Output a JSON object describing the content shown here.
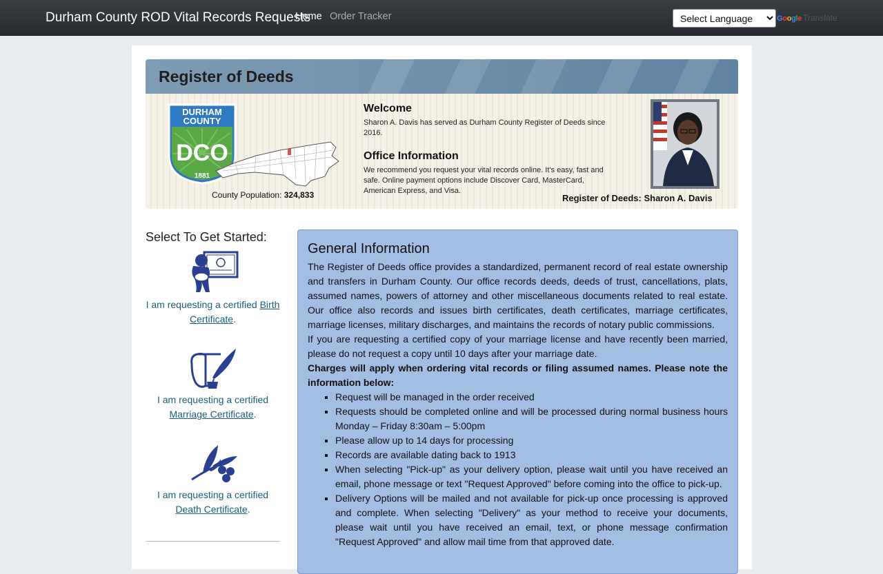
{
  "navbar": {
    "brand": "Durham County ROD Vital Records Requests",
    "home": "Home",
    "order_tracker": "Order Tracker",
    "language_select": "Select Language",
    "google": "Google",
    "translate": "Translate"
  },
  "banner": {
    "title": "Register of Deeds",
    "seal_line1": "DURHAM",
    "seal_line2": "COUNTY",
    "seal_initials": "DCO",
    "seal_year": "1881",
    "population_label": "County Population:",
    "population_value": "324,833",
    "welcome_heading": "Welcome",
    "welcome_text": "Sharon A. Davis has served as Durham County Register of Deeds since 2016.",
    "office_heading": "Office Information",
    "office_text": "We recommend you request your vital records online. It's easy, fast and safe. Online payment options include Discover Card, MasterCard, American Express, and Visa.",
    "register_name": "Register of Deeds: Sharon A. Davis"
  },
  "left": {
    "heading": "Select To Get Started:",
    "options": [
      {
        "prefix": "I am requesting a certified ",
        "link": "Birth Certificate",
        "suffix": ".",
        "icon": "baby-certificate-icon"
      },
      {
        "prefix": "I am requesting a certified ",
        "link": "Marriage Certificate",
        "suffix": ".",
        "icon": "scroll-quill-icon"
      },
      {
        "prefix": "I am requesting a certified ",
        "link": "Death Certificate",
        "suffix": ".",
        "icon": "olive-branch-icon"
      }
    ]
  },
  "info": {
    "heading": "General Information",
    "paragraph1": "The Register of Deeds office provides a standardized, permanent record of real estate ownership and transfers in Durham County. Our office records deeds, deeds of trust, cancellations, plats, assumed names, powers of attorney and other miscellaneous documents related to real estate. Our office also records and issues birth certificates, death certificates, marriage certificates, marriage licenses, military discharges, and maintains the records of notary public commissions.",
    "paragraph2": "If you are requesting a certified copy of your marriage license and have recently been married, please do not request a copy until 10 days after your marriage date.",
    "charges_note": "Charges will apply when ordering vital records or filing assumed names. Please note the information below:",
    "bullets": [
      "Request will be managed in the order received",
      "Requests should be completed online and will be processed during normal business hours Monday – Friday 8:30am – 5:00pm",
      "Please allow up to 14 days for processing",
      "Records are available dating back to 1913",
      "When selecting \"Pick-up\" as your delivery option, please wait until you have received an email, phone message or text \"Request Approved\" before coming into the office to pick-up.",
      "Delivery Options will be mailed and not available for pick-up once processing is approved and complete. When selecting \"Delivery\" as your method to receive your documents, please wait until you have received an email, text, or phone message confirmation \"Request Approved\" and allow mail time from that approved date."
    ]
  },
  "colors": {
    "navbar": "#272b30",
    "link": "#1a5e7a",
    "info_panel": "#a3bee3",
    "icon": "#2b3f8f",
    "seal_green": "#5aa846",
    "seal_blue": "#2f78c2"
  }
}
